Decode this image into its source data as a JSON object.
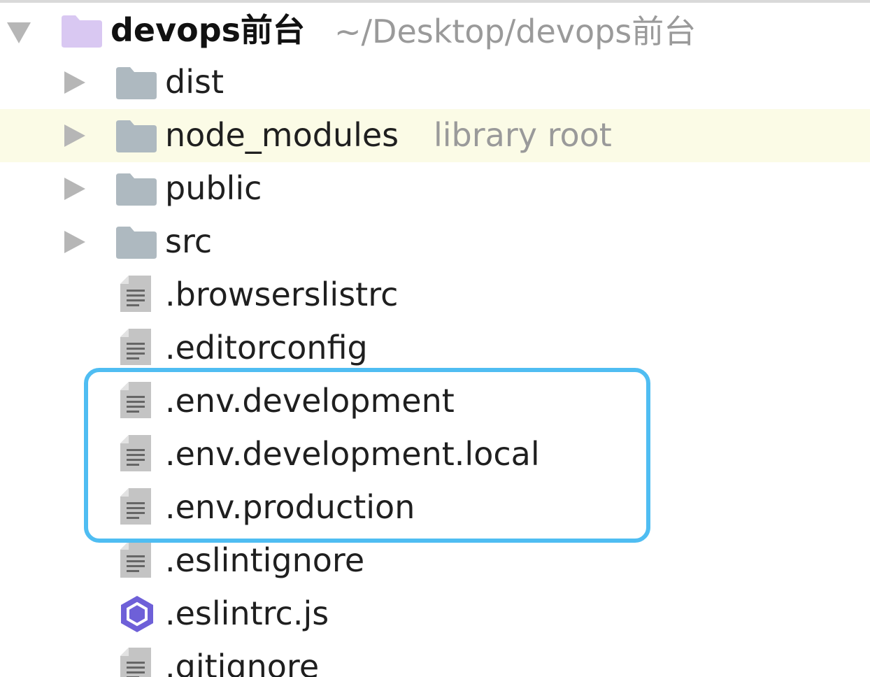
{
  "project": {
    "name": "devops前台",
    "path": "~/Desktop/devops前台"
  },
  "items": [
    {
      "label": "dist",
      "type": "folder",
      "expanded": false
    },
    {
      "label": "node_modules",
      "hint": "library root",
      "type": "folder",
      "expanded": false,
      "highlight": true
    },
    {
      "label": "public",
      "type": "folder",
      "expanded": false
    },
    {
      "label": "src",
      "type": "folder",
      "expanded": false
    },
    {
      "label": ".browserslistrc",
      "type": "text-file"
    },
    {
      "label": ".editorconfig",
      "type": "text-file"
    },
    {
      "label": ".env.development",
      "type": "text-file"
    },
    {
      "label": ".env.development.local",
      "type": "text-file"
    },
    {
      "label": ".env.production",
      "type": "text-file"
    },
    {
      "label": ".eslintignore",
      "type": "text-file"
    },
    {
      "label": ".eslintrc.js",
      "type": "eslint-file"
    },
    {
      "label": ".gitignore",
      "type": "text-file"
    }
  ],
  "colors": {
    "folder": "#aeb9c0",
    "root_folder": "#d9c8f2",
    "file": "#b8b8b8",
    "eslint": "#6e60d8",
    "selection_border": "#4fbdf2",
    "row_highlight": "#fbfbe6"
  }
}
